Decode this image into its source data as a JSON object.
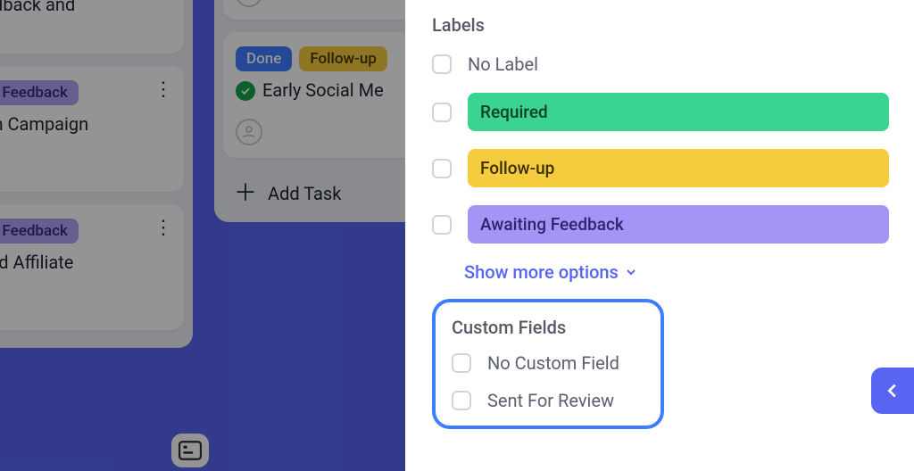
{
  "kanban": {
    "col1": {
      "card_a_title": "Feedback and\nls",
      "card_b_chip": "Awaiting Feedback",
      "card_b_title": "unch Campaign",
      "card_c_chip": "Awaiting Feedback",
      "card_c_title": "o and Affiliate"
    },
    "col2": {
      "card_a_chip1": "Done",
      "card_a_chip2": "Follow-up",
      "card_a_title": "Early Social Me",
      "add_task": "Add Task"
    }
  },
  "panel": {
    "labels_title": "Labels",
    "no_label": "No Label",
    "label_required": "Required",
    "label_followup": "Follow-up",
    "label_awaiting": "Awaiting Feedback",
    "show_more": "Show more options",
    "custom_fields_title": "Custom Fields",
    "no_custom_field": "No Custom Field",
    "sent_for_review": "Sent For Review"
  }
}
